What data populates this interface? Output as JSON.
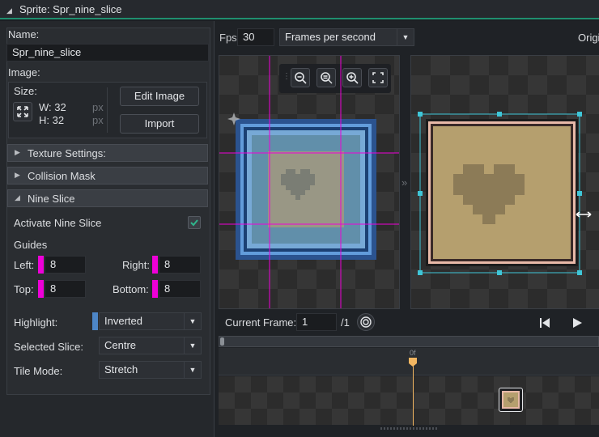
{
  "window": {
    "title": "Sprite: Spr_nine_slice"
  },
  "sprite": {
    "name_label": "Name:",
    "name_value": "Spr_nine_slice",
    "image_label": "Image:",
    "size_label": "Size:",
    "width_label": "W: 32",
    "height_label": "H: 32",
    "unit": "px",
    "edit_image_label": "Edit Image",
    "import_label": "Import"
  },
  "sections": {
    "texture": "Texture Settings:",
    "collision": "Collision Mask",
    "nine_slice": "Nine Slice"
  },
  "nine_slice": {
    "activate_label": "Activate Nine Slice",
    "activate_checked": true,
    "guides_label": "Guides",
    "left_label": "Left:",
    "left_value": "8",
    "right_label": "Right:",
    "right_value": "8",
    "top_label": "Top:",
    "top_value": "8",
    "bottom_label": "Bottom:",
    "bottom_value": "8",
    "highlight_label": "Highlight:",
    "highlight_value": "Inverted",
    "selected_slice_label": "Selected Slice:",
    "selected_slice_value": "Centre",
    "tile_mode_label": "Tile Mode:",
    "tile_mode_value": "Stretch"
  },
  "playback": {
    "fps_label": "Fps",
    "fps_value": "30",
    "fps_mode": "Frames per second",
    "origin_label": "Origi",
    "current_frame_label": "Current Frame:",
    "current_frame_value": "1",
    "frame_total": "/1",
    "timeline_marker": "0f"
  },
  "colors": {
    "accent_green": "#1f8f6f",
    "guide_magenta": "#ee00d8",
    "selection_cyan": "#3fc6d8",
    "marker_orange": "#f2b661"
  }
}
